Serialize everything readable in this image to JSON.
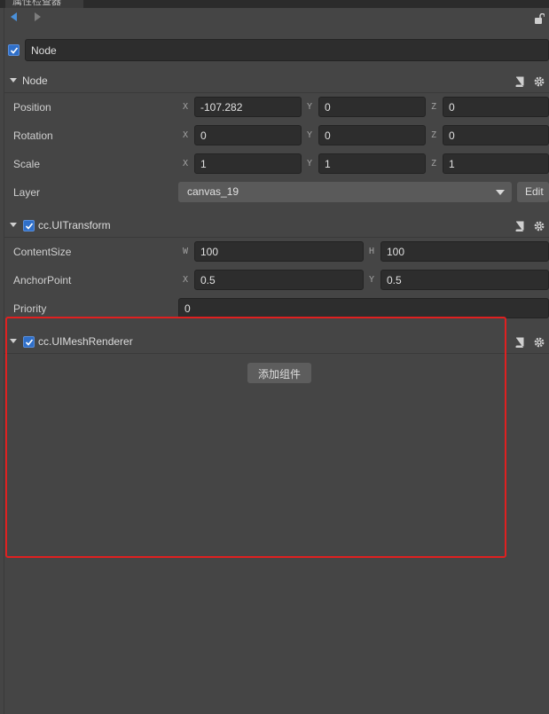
{
  "header": {
    "tab_title": "属性检查器",
    "node_enabled": true,
    "node_name": "Node"
  },
  "node_section": {
    "title": "Node",
    "rows": {
      "position": {
        "label": "Position",
        "x": "-107.282",
        "y": "0",
        "z": "0"
      },
      "rotation": {
        "label": "Rotation",
        "x": "0",
        "y": "0",
        "z": "0"
      },
      "scale": {
        "label": "Scale",
        "x": "1",
        "y": "1",
        "z": "1"
      },
      "layer": {
        "label": "Layer",
        "value": "canvas_19",
        "edit_label": "Edit"
      }
    },
    "axis_labels": {
      "x": "X",
      "y": "Y",
      "z": "Z",
      "w": "W",
      "h": "H"
    }
  },
  "transform_section": {
    "title": "cc.UITransform",
    "enabled": true,
    "content_size": {
      "label": "ContentSize",
      "w": "100",
      "h": "100"
    },
    "anchor_point": {
      "label": "AnchorPoint",
      "x": "0.5",
      "y": "0.5"
    },
    "priority": {
      "label": "Priority",
      "value": "0"
    }
  },
  "mesh_section": {
    "title": "cc.UIMeshRenderer",
    "enabled": true
  },
  "add_component_label": "添加组件",
  "colors": {
    "background": "#454545",
    "field_bg": "#2d2d2d",
    "accent": "#2f6fc9",
    "highlight": "#e02020"
  }
}
